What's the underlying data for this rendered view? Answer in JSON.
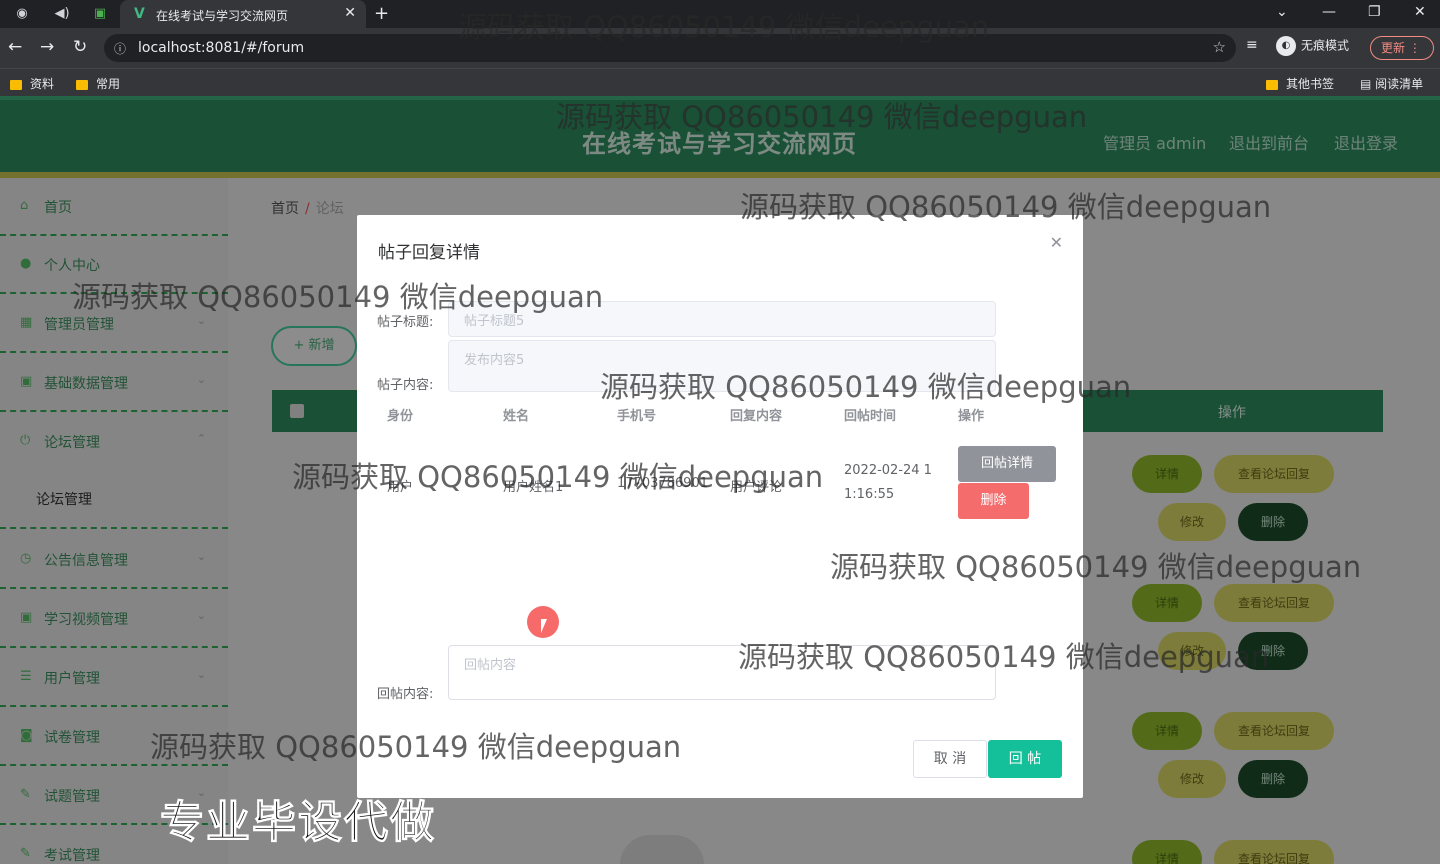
{
  "browser": {
    "tab_title": "在线考试与学习交流网页",
    "url": "localhost:8081/#/forum",
    "incognito_label": "无痕模式",
    "update_label": "更新",
    "bookmarks": [
      "资料",
      "常用"
    ],
    "bookmarks_right": [
      "其他书签",
      "阅读清单"
    ]
  },
  "app": {
    "title": "在线考试与学习交流网页",
    "header_links": [
      "管理员 admin",
      "退出到前台",
      "退出登录"
    ],
    "breadcrumb": [
      "首页",
      "论坛"
    ],
    "add_button": "+ 新增",
    "table_op_header": "操作",
    "row_buttons": {
      "detail": "详情",
      "view_replies": "查看论坛回复",
      "edit": "修改",
      "delete": "删除"
    },
    "sidebar": [
      {
        "label": "首页",
        "icon": "home-icon"
      },
      {
        "label": "个人中心",
        "icon": "user-icon"
      },
      {
        "label": "管理员管理",
        "icon": "grid-icon"
      },
      {
        "label": "基础数据管理",
        "icon": "data-icon"
      },
      {
        "label": "论坛管理",
        "icon": "power-icon"
      },
      {
        "label": "公告信息管理",
        "icon": "clock-icon"
      },
      {
        "label": "学习视频管理",
        "icon": "video-icon"
      },
      {
        "label": "用户管理",
        "icon": "list-icon"
      },
      {
        "label": "试卷管理",
        "icon": "chat-icon"
      },
      {
        "label": "试题管理",
        "icon": "edit-icon"
      },
      {
        "label": "考试管理",
        "icon": "exam-icon"
      }
    ],
    "sidebar_sub": "论坛管理"
  },
  "modal": {
    "title": "帖子回复详情",
    "label_title": "帖子标题:",
    "value_title": "帖子标题5",
    "label_content": "帖子内容:",
    "value_content": "发布内容5",
    "columns": [
      "身份",
      "姓名",
      "手机号",
      "回复内容",
      "回帖时间",
      "操作"
    ],
    "rows": [
      {
        "role": "用户",
        "name": "用户姓名1",
        "phone": "17703786901",
        "reply": "用户评论",
        "time_1": "2022-02-24 1",
        "time_2": "1:16:55"
      }
    ],
    "btn_detail": "回帖详情",
    "btn_delete": "删除",
    "label_reply": "回帖内容:",
    "placeholder_reply": "回帖内容",
    "btn_cancel": "取 消",
    "btn_submit": "回 帖"
  },
  "watermark": "源码获取 QQ86050149 微信deepguan",
  "promo": "专业毕设代做"
}
